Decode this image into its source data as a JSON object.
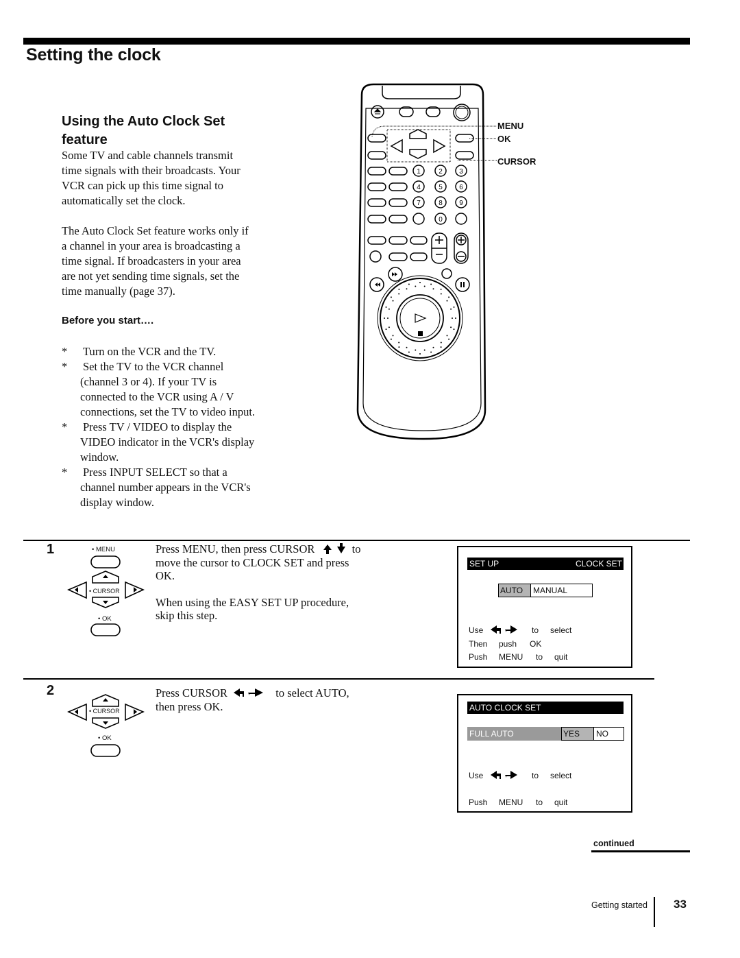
{
  "page": {
    "title": "Setting the clock",
    "section_title": "Using the Auto Clock Set feature",
    "intro_lines": [
      "Some TV and cable channels transmit",
      "time signals with their broadcasts.  Your",
      "VCR can pick up this time signal to",
      "automatically set the clock."
    ],
    "note_lines": [
      "The Auto Clock Set feature works only if",
      "a channel in your area is broadcasting a",
      "time signal.  If broadcasters in your area",
      "are not yet sending time signals, set the",
      "time manually (page 37)."
    ],
    "before_heading": "Before you start….",
    "bullet_marker": "*",
    "bullets": [
      [
        "Turn on the VCR and the TV."
      ],
      [
        "Set the TV to the VCR channel",
        "(channel 3 or 4).  If your TV is",
        "connected to the VCR using A / V",
        "connections, set the TV to video input."
      ],
      [
        "Press TV / VIDEO to display the",
        "VIDEO indicator in the VCR's display",
        "window."
      ],
      [
        "Press INPUT SELECT so that a",
        "channel number appears in the VCR's",
        "display window."
      ]
    ]
  },
  "remote": {
    "callouts": [
      "MENU",
      "OK",
      "CURSOR"
    ],
    "number_keys": [
      "1",
      "2",
      "3",
      "4",
      "5",
      "6",
      "7",
      "8",
      "9",
      "0"
    ]
  },
  "steps": [
    {
      "number": "1",
      "button_labels": {
        "menu": "• MENU",
        "cursor": "• CURSOR",
        "ok": "• OK"
      },
      "text_lines": [
        "Press MENU, then press CURSOR",
        "move the cursor to CLOCK SET and press",
        "OK."
      ],
      "text_after_arrows": "to",
      "arrows": "up-down",
      "note_lines": [
        "When using the EASY SET UP procedure,",
        "skip this step."
      ],
      "screen": {
        "header_left": "SET UP",
        "header_right": "CLOCK SET",
        "options": [
          "AUTO",
          "MANUAL"
        ],
        "selected_option": "AUTO",
        "help": [
          [
            "Use",
            "to",
            "select"
          ],
          [
            "Then",
            "push",
            "OK"
          ],
          [
            "Push",
            "MENU",
            "to",
            "quit"
          ]
        ]
      }
    },
    {
      "number": "2",
      "button_labels": {
        "cursor": "• CURSOR",
        "ok": "• OK"
      },
      "text_lines": [
        "Press CURSOR",
        "then press OK."
      ],
      "text_after_arrows": "to select AUTO,",
      "arrows": "left-right",
      "screen": {
        "header_left": "AUTO CLOCK SET",
        "row_label": "FULL AUTO",
        "options": [
          "YES",
          "NO"
        ],
        "selected_option": "YES",
        "help": [
          [
            "Use",
            "to",
            "select"
          ],
          [
            "Push",
            "MENU",
            "to",
            "quit"
          ]
        ]
      }
    }
  ],
  "footer": {
    "continued": "continued",
    "section": "Getting started",
    "page_number": "33"
  },
  "colors": {
    "ink": "#000000",
    "highlight_gray": "#b4b4b4",
    "full_auto_gray": "#9a9a9a"
  }
}
